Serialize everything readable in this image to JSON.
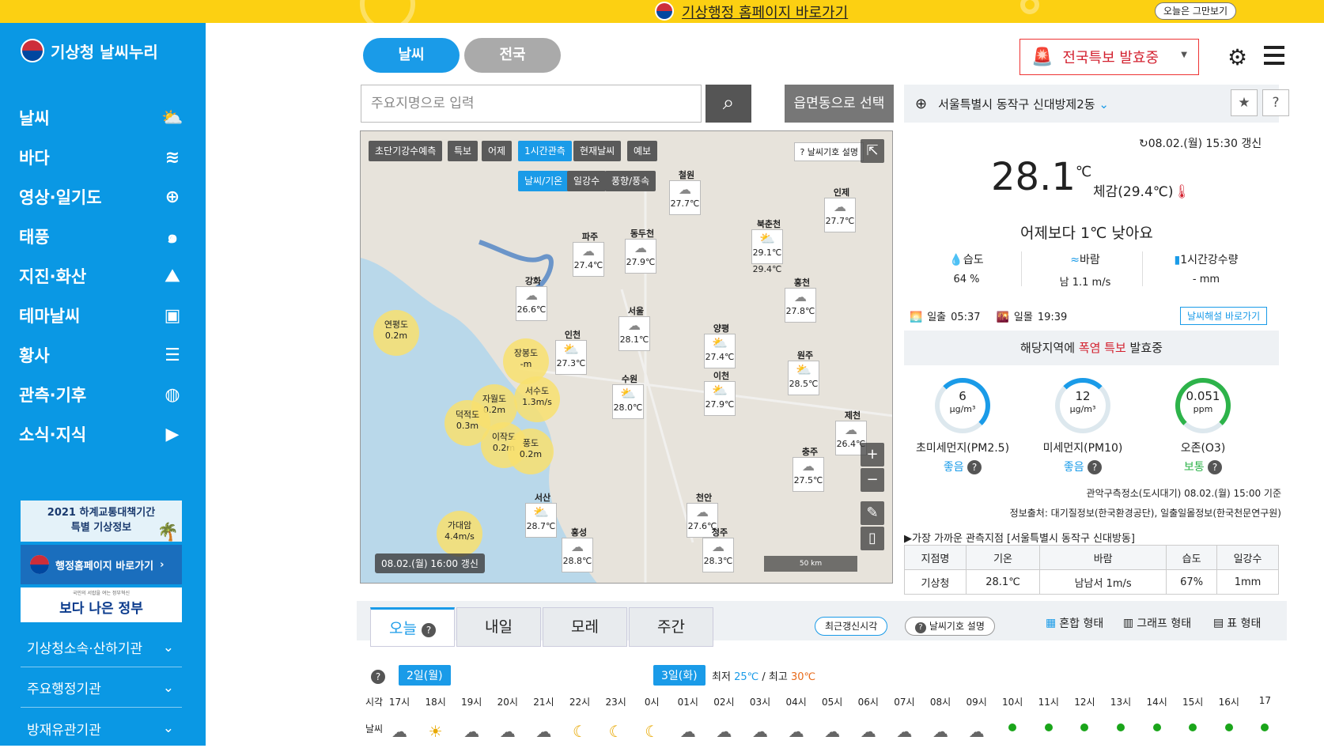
{
  "topbar": {
    "link_text": "기상행정 홈페이지 바로가기",
    "close_label": "오늘은 그만보기"
  },
  "sidebar": {
    "logo": "기상청 날씨누리",
    "items": [
      {
        "label": "날씨",
        "icon": "sun-cloud-icon"
      },
      {
        "label": "바다",
        "icon": "wave-icon"
      },
      {
        "label": "영상·일기도",
        "icon": "satellite-icon"
      },
      {
        "label": "태풍",
        "icon": "typhoon-icon"
      },
      {
        "label": "지진·화산",
        "icon": "volcano-icon"
      },
      {
        "label": "테마날씨",
        "icon": "suitcase-icon"
      },
      {
        "label": "황사",
        "icon": "dust-icon"
      },
      {
        "label": "관측·기후",
        "icon": "globe-icon"
      },
      {
        "label": "소식·지식",
        "icon": "play-icon"
      }
    ],
    "promo_line1": "2021 하계교통대책기간",
    "promo_line2": "특별 기상정보",
    "gov_link": "행정홈페이지 바로가기",
    "better_small": "국민의 서랍을 여는 정부혁신",
    "better": "보다 나은 정부",
    "accordion": [
      "기상청소속·산하기관",
      "주요행정기관",
      "방재유관기관"
    ]
  },
  "header": {
    "tab_weather": "날씨",
    "tab_nation": "전국",
    "alert": "전국특보 발효중",
    "search_placeholder": "주요지명으로 입력",
    "eup_button": "읍면동으로 선택",
    "location": "서울특별시 동작구 신대방제2동"
  },
  "map": {
    "tabs": [
      "초단기강수예측",
      "특보",
      "어제",
      "1시간관측",
      "현재날씨",
      "예보"
    ],
    "active_tab": "1시간관측",
    "subtabs": [
      "날씨/기온",
      "일강수",
      "풍향/풍속"
    ],
    "note": "날씨기호 설명",
    "stamp": "08.02.(월) 16:00 갱신",
    "scale": "50 km",
    "stations": [
      {
        "name": "철원",
        "temp": "27.7℃"
      },
      {
        "name": "인제",
        "temp": "27.7℃"
      },
      {
        "name": "파주",
        "temp": "27.4℃"
      },
      {
        "name": "동두천",
        "temp": "27.9℃"
      },
      {
        "name": "북춘천",
        "temp": "29.1℃"
      },
      {
        "name": "강화",
        "temp": "26.6℃"
      },
      {
        "name": "홍천",
        "temp": "27.8℃"
      },
      {
        "name": "서울",
        "temp": "28.1℃"
      },
      {
        "name": "인천",
        "temp": "27.3℃"
      },
      {
        "name": "양평",
        "temp": "27.4℃"
      },
      {
        "name": "원주",
        "temp": "28.5℃"
      },
      {
        "name": "수원",
        "temp": "28.0℃"
      },
      {
        "name": "이천",
        "temp": "27.9℃"
      },
      {
        "name": "제천",
        "temp": "26.4℃"
      },
      {
        "name": "충주",
        "temp": "27.5℃"
      },
      {
        "name": "서산",
        "temp": "28.7℃"
      },
      {
        "name": "천안",
        "temp": "27.6℃"
      },
      {
        "name": "홍성",
        "temp": "28.8℃"
      },
      {
        "name": "청주",
        "temp": "28.3℃"
      }
    ],
    "chuncheon_extra": "29.4℃",
    "bubbles": [
      {
        "name": "연평도",
        "val": "0.2m"
      },
      {
        "name": "장봉도",
        "val": "-m"
      },
      {
        "name": "자월도",
        "val": "0.2m"
      },
      {
        "name": "서수도",
        "val": "1.3m/s"
      },
      {
        "name": "덕적도",
        "val": "0.3m"
      },
      {
        "name": "이작도",
        "val": "0.2m"
      },
      {
        "name": "풍도",
        "val": "0.2m"
      },
      {
        "name": "가대암",
        "val": "4.4m/s"
      }
    ]
  },
  "current": {
    "updated": "08.02.(월) 15:30 갱신",
    "temp": "28.1",
    "unit": "℃",
    "feels": "체감(29.4℃)",
    "yesterday": "어제보다 1℃ 낮아요",
    "humidity_label": "습도",
    "humidity": "64 %",
    "wind_label": "바람",
    "wind": "남 1.1 m/s",
    "rain_label": "1시간강수량",
    "rain": "- mm",
    "sunrise_label": "일출",
    "sunrise": "05:37",
    "sunset_label": "일몰",
    "sunset": "19:39",
    "explain": "날씨해설 바로가기",
    "warn_pre": "해당지역에 ",
    "warn_red": "폭염 특보",
    "warn_post": " 발효중",
    "pm25_val": "6",
    "pm25_unit": "μg/m³",
    "pm25_label": "초미세먼지(PM2.5)",
    "pm25_status": "좋음",
    "pm10_val": "12",
    "pm10_unit": "μg/m³",
    "pm10_label": "미세먼지(PM10)",
    "pm10_status": "좋음",
    "o3_val": "0.051",
    "o3_unit": "ppm",
    "o3_label": "오존(O3)",
    "o3_status": "보통",
    "source1": "관악구측정소(도시대기) 08.02.(월) 15:00 기준",
    "source2": "정보출처: 대기질정보(한국환경공단), 일출일몰정보(한국천문연구원)",
    "nearest": "▶가장 가까운 관측지점 [서울특별시 동작구 신대방동]",
    "table_headers": [
      "지점명",
      "기온",
      "바람",
      "습도",
      "일강수"
    ],
    "table_row": [
      "기상청",
      "28.1℃",
      "남남서 1m/s",
      "67%",
      "1mm"
    ]
  },
  "forecast": {
    "tabs": [
      "오늘",
      "내일",
      "모레",
      "주간"
    ],
    "recent_btn": "최근갱신시각",
    "legend_btn": "날씨기호 설명",
    "views": [
      "혼합 형태",
      "그래프 형태",
      "표 형태"
    ],
    "day1": "2일(월)",
    "day2": "3일(화)",
    "min_label": "최저",
    "min": "25℃",
    "max_label": "최고",
    "max": "30℃",
    "sep": "/",
    "row_time": "시각",
    "row_weather": "날씨",
    "hours": [
      "17시",
      "18시",
      "19시",
      "20시",
      "21시",
      "22시",
      "23시",
      "0시",
      "01시",
      "02시",
      "03시",
      "04시",
      "05시",
      "06시",
      "07시",
      "08시",
      "09시",
      "10시",
      "11시",
      "12시",
      "13시",
      "14시",
      "15시",
      "16시",
      "17"
    ]
  },
  "colors": {
    "sidebar": "#0a98e4",
    "banner": "#fcd012",
    "accent": "#1a9be8",
    "alert": "#d3212f"
  }
}
